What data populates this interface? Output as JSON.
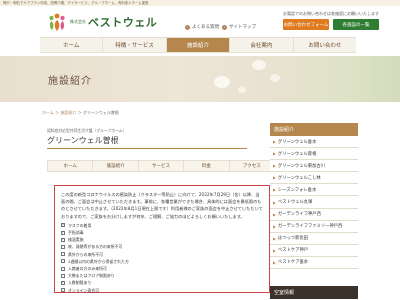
{
  "header": {
    "tagline": "神戸・明石でケアプラン作成、訪問介護、デイサービス、グループホーム、有料老人ホーム運営",
    "logo_small": "株式会社",
    "logo_name": "ベストウェル",
    "faq_label": "よくある質問",
    "sitemap_label": "サイトマップ",
    "contact_note": "お電話でのお問い合わせは各施設にお願いいたします",
    "form_button": "お問い合わせフォーム",
    "phone_button": "各施設の一覧"
  },
  "nav": {
    "items": [
      "ホーム",
      "特徴・サービス",
      "施設紹介",
      "会社案内",
      "お問い合わせ"
    ],
    "active_index": 2
  },
  "banner": {
    "title": "施設紹介"
  },
  "breadcrumb": {
    "home": "ホーム",
    "parent": "施設紹介",
    "current": "グリーンウェル曽根"
  },
  "main": {
    "subtitle": "認知症対応型共同生活介護（グループホーム）",
    "title": "グリーンウェル曽根",
    "tabs": [
      "ホーム",
      "施設紹介",
      "サービス",
      "料金",
      "アクセス"
    ]
  },
  "notice": {
    "text": "この度の新型コロナウイルスの感染防止（クラスター等防止）に向けて、2022年7月29日（金）以降、当面の間、ご面会は中止させていただきます。事前に、各種営業ができた場合、具体的には面会を最低限のものとさせていただきます。（2022年8月1日現在上限です）利用者様のご家族の面会を中止させていただいておりますので、ご家族をお分けしますが何卒、ご理解、ご協力のほどよろしくお願いいたします。",
    "checks": [
      {
        "label": "マスクの着用",
        "checked": true
      },
      {
        "label": "手指消毒",
        "checked": true
      },
      {
        "label": "検温実施",
        "checked": true
      },
      {
        "label": "咳、発熱等がある方の来所不可",
        "checked": false
      },
      {
        "label": "県外からの来所不可",
        "checked": false
      },
      {
        "label": "2週間以内の県外から帰省された方",
        "checked": false
      },
      {
        "label": "入館者の方のみ来所可",
        "checked": false
      },
      {
        "label": "大勢またはフロア制限あり",
        "checked": false
      },
      {
        "label": "入数制限あり",
        "checked": true
      },
      {
        "label": "オンライン面会可",
        "checked": false
      }
    ]
  },
  "sidebar": {
    "heading": "施設紹介",
    "items": [
      "グリーンウェル垂水",
      "グリーンウェル曽根",
      "グリーンウェル東加古川",
      "グリーンウェルこし林",
      "シーズンフォレ垂水",
      "ベストウェル丸塚",
      "ガーデンライフ神戸西",
      "ガーデンライフファミリー神戸西",
      "はつっつ新長田",
      "ベストケア神戸",
      "ベストケア垂水"
    ],
    "heading2": "空室情報"
  }
}
